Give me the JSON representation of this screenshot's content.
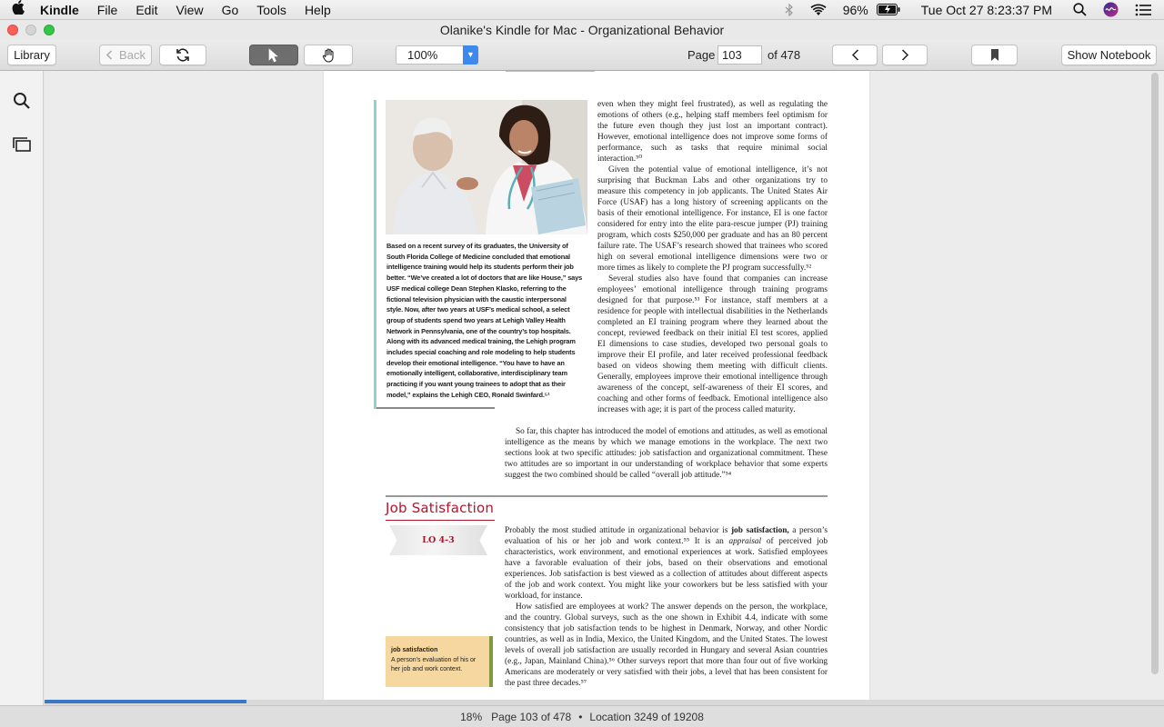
{
  "menubar": {
    "app_name": "Kindle",
    "items": [
      "File",
      "Edit",
      "View",
      "Go",
      "Tools",
      "Help"
    ],
    "battery": "96%",
    "clock": "Tue Oct 27  8:23:37 PM"
  },
  "window": {
    "title": "Olanike's Kindle for Mac - Organizational Behavior"
  },
  "toolbar": {
    "library_label": "Library",
    "back_label": "Back",
    "zoom": "100%",
    "page_label": "Page",
    "page_value": "103",
    "page_total": "of 478",
    "show_notebook_label": "Show Notebook"
  },
  "book_page": {
    "caption": "Based on a recent survey of its graduates, the University of South Florida College of Medicine concluded that emotional intelligence training would help its students perform their job better. “We’ve created a lot of doctors that are like House,” says USF medical college Dean Stephen Klasko, referring to the fictional television physician with the caustic interpersonal style. Now, after two years at USF’s medical school, a select group of students spend two years at Lehigh Valley Health Network in Pennsylvania, one of the country’s top hospitals. Along with its advanced medical training, the Lehigh program includes special coaching and role modeling to help students develop their emotional intelligence. “You have to have an emotionally intelligent, collaborative, interdisciplinary team practicing if you want young trainees to adopt that as their model,” explains the Lehigh CEO, Ronald Swinfard.⁵¹",
    "para1": "even when they might feel frustrated), as well as regulating the emotions of others (e.g., helping staff members feel optimism for the future even though they just lost an important contract). However, emotional intelligence does not improve some forms of performance, such as tasks that require minimal social interaction.⁵⁰",
    "para2": "Given the potential value of emotional intelligence, it’s not surprising that Buckman Labs and other organizations try to measure this competency in job applicants. The United States Air Force (USAF) has a long history of screening applicants on the basis of their emotional intelligence. For instance, EI is one factor considered for entry into the elite para-rescue jumper (PJ) training program, which costs $250,000 per graduate and has an 80 percent failure rate. The USAF’s research showed that trainees who scored high on several emotional intelligence dimensions were two or more times as likely to complete the PJ program successfully.⁵²",
    "para3": "Several studies also have found that companies can increase employees’ emotional intelligence through training programs designed for that purpose.⁵³ For instance, staff members at a residence for people with intellectual disabilities in the Netherlands completed an EI training program where they learned about the concept, reviewed feedback on their initial EI test scores, applied EI dimensions to case studies, developed two personal goals to improve their EI profile, and later received professional feedback based on videos showing them meeting with difficult clients. Generally, employees improve their emotional intelligence through awareness of the concept, self-awareness of their EI scores, and coaching and other forms of feedback. Emotional intelligence also increases with age; it is part of the process called maturity.",
    "para4": "So far, this chapter has introduced the model of emotions and attitudes, as well as emotional intelligence as the means by which we manage emotions in the workplace. The next two sections look at two specific attitudes: job satisfaction and organizational commitment. These two attitudes are so important in our understanding of workplace behavior that some experts suggest the two combined should be called “overall job attitude.”⁵⁴",
    "section_title": "Job Satisfaction",
    "lo_badge": "LO 4-3",
    "para5_a": "Probably the most studied attitude in organizational behavior is ",
    "para5_term": "job satisfaction,",
    "para5_b": " a person’s evaluation of his or her job and work context.⁵⁵ It is an ",
    "para5_em": "appraisal",
    "para5_c": " of perceived job characteristics, work environment, and emotional experiences at work. Satisfied employees have a favorable evaluation of their jobs, based on their observations and emotional experiences. Job satisfaction is best viewed as a collection of attitudes about different aspects of the job and work context. You might like your coworkers but be less satisfied with your workload, for instance.",
    "para6": "How satisfied are employees at work? The answer depends on the person, the workplace, and the country. Global surveys, such as the one shown in Exhibit 4.4, indicate with some consistency that job satisfaction tends to be highest in Denmark, Norway, and other Nordic countries, as well as in India, Mexico, the United Kingdom, and the United States. The lowest levels of overall job satisfaction are usually recorded in Hungary and several Asian countries (e.g., Japan, Mainland China).⁵⁶ Other surveys report that more than four out of five working Americans are moderately or very satisfied with their jobs, a level that has been consistent for the past three decades.⁵⁷",
    "def_term": "job satisfaction",
    "def_text": "A person’s evaluation of his or her job and work context."
  },
  "status": {
    "percent": "18%",
    "page": "Page 103 of 478",
    "location": "Location 3249 of 19208",
    "progress_fraction": 0.18
  },
  "colors": {
    "accent": "#3d89ec",
    "section_title": "#b5152b",
    "definition_bg": "#f6d7a0"
  }
}
